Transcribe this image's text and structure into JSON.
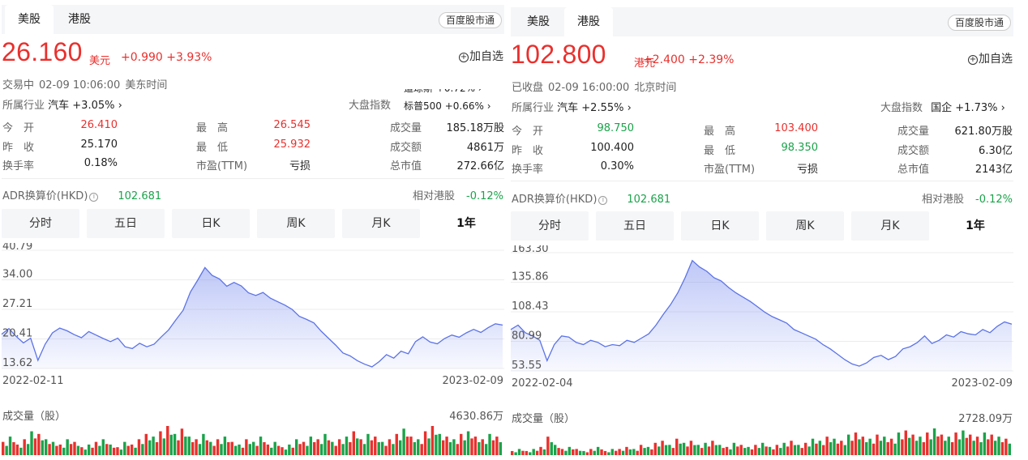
{
  "panels": [
    {
      "tabs": [
        "美股",
        "港股"
      ],
      "active_tab": 0,
      "connect_label": "百度股市通",
      "price": "26.160",
      "currency": "美元",
      "change": "+0.990 +3.93%",
      "add_watch": "加自选",
      "status": "交易中",
      "time": "02-09 10:06:00",
      "tz": "美东时间",
      "industry_label": "所属行业",
      "industry_value": "汽车 +3.05% ›",
      "market_label": "大盘指数",
      "market_lines": [
        "道琼斯 +0.72% ›",
        "标普500 +0.66% ›"
      ],
      "stats": [
        {
          "label": "今　开",
          "value": "26.410",
          "color": "up"
        },
        {
          "label": "最　高",
          "value": "26.545",
          "color": "up"
        },
        {
          "label": "成交量",
          "value": "185.18万股",
          "color": ""
        },
        {
          "label": "昨　收",
          "value": "25.170",
          "color": ""
        },
        {
          "label": "最　低",
          "value": "25.932",
          "color": "up"
        },
        {
          "label": "成交额",
          "value": "4861万",
          "color": ""
        },
        {
          "label": "换手率",
          "value": "0.18%",
          "color": ""
        },
        {
          "label": "市盈(TTM)",
          "value": "亏损",
          "color": ""
        },
        {
          "label": "总市值",
          "value": "272.66亿",
          "color": ""
        }
      ],
      "adr_label": "ADR换算价(HKD)",
      "adr_value": "102.681",
      "rel_label": "相对港股",
      "rel_value": "-0.12%",
      "periods": [
        "分时",
        "五日",
        "日K",
        "周K",
        "月K",
        "1年"
      ],
      "active_period": 5,
      "volume_label": "成交量（股）",
      "volume_max": "4630.86万",
      "colors": {
        "up": "#e9302d",
        "down": "#1aa34a",
        "line": "#5b73e8"
      }
    },
    {
      "tabs": [
        "美股",
        "港股"
      ],
      "active_tab": 1,
      "connect_label": "百度股市通",
      "price": "102.800",
      "currency": "港元",
      "change": "+2.400 +2.39%",
      "add_watch": "加自选",
      "status": "已收盘",
      "time": "02-09 16:00:00",
      "tz": "北京时间",
      "industry_label": "所属行业",
      "industry_value": "汽车 +2.55% ›",
      "market_label": "大盘指数",
      "market_value": "国企 +1.73% ›",
      "stats": [
        {
          "label": "今　开",
          "value": "98.750",
          "color": "down"
        },
        {
          "label": "最　高",
          "value": "103.400",
          "color": "up"
        },
        {
          "label": "成交量",
          "value": "621.80万股",
          "color": ""
        },
        {
          "label": "昨　收",
          "value": "100.400",
          "color": ""
        },
        {
          "label": "最　低",
          "value": "98.350",
          "color": "down"
        },
        {
          "label": "成交额",
          "value": "6.30亿",
          "color": ""
        },
        {
          "label": "换手率",
          "value": "0.30%",
          "color": ""
        },
        {
          "label": "市盈(TTM)",
          "value": "亏损",
          "color": ""
        },
        {
          "label": "总市值",
          "value": "2143亿",
          "color": ""
        }
      ],
      "adr_label": "ADR换算价(HKD)",
      "adr_value": "102.681",
      "rel_label": "相对港股",
      "rel_value": "-0.12%",
      "periods": [
        "分时",
        "五日",
        "日K",
        "周K",
        "月K",
        "1年"
      ],
      "active_period": 5,
      "volume_label": "成交量（股）",
      "volume_max": "2728.09万",
      "colors": {
        "up": "#e9302d",
        "down": "#1aa34a",
        "line": "#5b73e8"
      }
    }
  ],
  "chart_data": [
    {
      "type": "area",
      "title": "",
      "x_start": "2022-02-11",
      "x_end": "2023-02-09",
      "x_tick_labels": [
        "2022-02-11",
        "2023-02-09"
      ],
      "y_tick_labels": [
        "40.79",
        "34.00",
        "27.21",
        "20.41",
        "13.62"
      ],
      "ylim": [
        13.62,
        40.79
      ],
      "grid": true,
      "series": [
        {
          "values": [
            21.5,
            22.8,
            21.0,
            19.5,
            20.6,
            15.5,
            19.2,
            21.8,
            22.9,
            22.3,
            21.4,
            20.7,
            22.1,
            21.3,
            20.5,
            19.8,
            20.6,
            18.6,
            18.2,
            19.4,
            18.6,
            19.2,
            20.9,
            22.5,
            24.8,
            27.0,
            31.2,
            33.9,
            36.8,
            35.0,
            34.2,
            32.5,
            33.4,
            32.6,
            31.0,
            30.4,
            31.1,
            29.8,
            29.0,
            28.2,
            27.2,
            25.6,
            24.9,
            24.1,
            22.2,
            20.6,
            19.0,
            17.2,
            16.5,
            15.4,
            14.6,
            14.0,
            15.2,
            16.8,
            16.0,
            17.6,
            17.0,
            19.8,
            20.9,
            19.7,
            19.3,
            20.5,
            21.3,
            20.8,
            21.8,
            22.6,
            21.9,
            23.0,
            23.9,
            23.6
          ]
        }
      ],
      "volume": [
        5,
        7,
        4,
        6,
        9,
        8,
        6,
        5,
        4,
        6,
        5,
        3,
        4,
        5,
        6,
        4,
        3,
        5,
        4,
        6,
        8,
        7,
        9,
        11,
        8,
        10,
        7,
        6,
        8,
        5,
        6,
        7,
        5,
        4,
        6,
        5,
        7,
        4,
        5,
        3,
        4,
        6,
        5,
        7,
        6,
        8,
        5,
        6,
        7,
        9,
        6,
        8,
        7,
        5,
        6,
        8,
        10,
        7,
        6,
        9,
        11,
        8,
        7,
        6,
        8,
        9,
        7,
        6,
        8,
        7
      ],
      "volume_dir": [
        1,
        0,
        1,
        1,
        0,
        1,
        0,
        0,
        1,
        0,
        1,
        1,
        0,
        1,
        0,
        0,
        1,
        0,
        1,
        1,
        1,
        0,
        1,
        1,
        0,
        1,
        0,
        1,
        0,
        0,
        1,
        0,
        1,
        0,
        1,
        0,
        0,
        1,
        0,
        1,
        0,
        0,
        1,
        0,
        1,
        0,
        0,
        1,
        0,
        1,
        1,
        0,
        1,
        0,
        1,
        1,
        0,
        1,
        0,
        1,
        1,
        0,
        1,
        0,
        1,
        0,
        1,
        1,
        0,
        1
      ]
    },
    {
      "type": "area",
      "title": "",
      "x_start": "2022-02-04",
      "x_end": "2023-02-09",
      "x_tick_labels": [
        "2022-02-04",
        "2023-02-09"
      ],
      "y_tick_labels": [
        "163.30",
        "135.86",
        "108.43",
        "80.99",
        "53.55"
      ],
      "ylim": [
        53.55,
        163.3
      ],
      "grid": true,
      "series": [
        {
          "values": [
            92.0,
            96.0,
            89.0,
            86.0,
            82.0,
            63.0,
            78.0,
            86.0,
            85.0,
            80.0,
            78.0,
            82.0,
            80.0,
            76.0,
            78.0,
            77.0,
            82.0,
            80.0,
            84.0,
            88.0,
            96.0,
            106.0,
            115.0,
            126.0,
            140.0,
            156.0,
            150.0,
            146.0,
            140.0,
            137.0,
            131.0,
            126.0,
            122.0,
            118.0,
            113.0,
            108.0,
            104.0,
            101.0,
            98.0,
            92.0,
            89.0,
            86.0,
            83.0,
            78.0,
            74.0,
            69.0,
            64.0,
            60.0,
            58.0,
            61.0,
            66.0,
            68.0,
            64.0,
            67.0,
            74.0,
            76.0,
            80.0,
            86.0,
            79.0,
            82.0,
            87.0,
            85.0,
            90.0,
            88.0,
            87.0,
            92.0,
            89.0,
            95.0,
            99.0,
            97.0
          ]
        }
      ],
      "volume": [
        2,
        3,
        2,
        3,
        4,
        9,
        5,
        3,
        4,
        3,
        2,
        3,
        4,
        2,
        3,
        3,
        4,
        3,
        5,
        4,
        6,
        7,
        5,
        8,
        6,
        7,
        5,
        6,
        7,
        5,
        4,
        6,
        5,
        4,
        5,
        6,
        4,
        5,
        6,
        7,
        5,
        6,
        8,
        7,
        9,
        8,
        7,
        10,
        11,
        9,
        8,
        10,
        9,
        8,
        11,
        12,
        10,
        9,
        11,
        13,
        10,
        9,
        11,
        12,
        10,
        9,
        11,
        10,
        9,
        8
      ],
      "volume_dir": [
        1,
        0,
        1,
        0,
        1,
        1,
        0,
        1,
        0,
        1,
        0,
        1,
        0,
        1,
        0,
        1,
        1,
        0,
        1,
        0,
        1,
        1,
        0,
        1,
        0,
        1,
        0,
        0,
        1,
        0,
        1,
        0,
        1,
        0,
        1,
        0,
        0,
        1,
        0,
        1,
        0,
        1,
        0,
        0,
        1,
        0,
        1,
        0,
        1,
        1,
        0,
        1,
        0,
        1,
        0,
        1,
        1,
        0,
        1,
        0,
        1,
        0,
        1,
        0,
        1,
        1,
        0,
        1,
        0,
        1
      ]
    }
  ]
}
